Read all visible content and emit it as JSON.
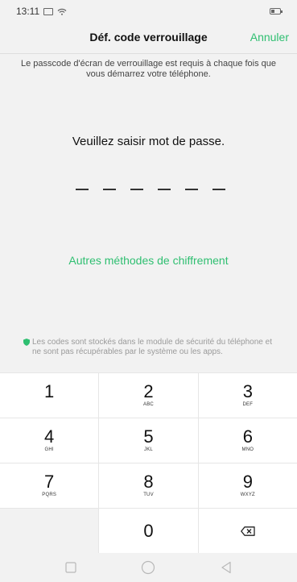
{
  "status": {
    "time": "13:11",
    "battery_level": 0.4
  },
  "header": {
    "title": "Déf. code verrouillage",
    "cancel_label": "Annuler"
  },
  "info_text": "Le passcode d'écran de verrouillage est requis à chaque fois que vous démarrez votre téléphone.",
  "prompt_text": "Veuillez saisir mot de passe.",
  "passcode": {
    "length": 6,
    "entered": 0
  },
  "alt_methods_label": "Autres méthodes de chiffrement",
  "security_note": "Les codes sont stockés dans le module de sécurité du téléphone et ne sont pas récupérables par le système ou les apps.",
  "keypad": {
    "rows": [
      [
        {
          "num": "1",
          "letters": ""
        },
        {
          "num": "2",
          "letters": "ABC"
        },
        {
          "num": "3",
          "letters": "DEF"
        }
      ],
      [
        {
          "num": "4",
          "letters": "GHI"
        },
        {
          "num": "5",
          "letters": "JKL"
        },
        {
          "num": "6",
          "letters": "MNO"
        }
      ],
      [
        {
          "num": "7",
          "letters": "PQRS"
        },
        {
          "num": "8",
          "letters": "TUV"
        },
        {
          "num": "9",
          "letters": "WXYZ"
        }
      ]
    ],
    "zero": "0"
  },
  "colors": {
    "accent": "#2fbf71",
    "background": "#f2f2f2"
  },
  "icons": {
    "delete": "backspace-icon",
    "home": "circle-home-icon",
    "recents": "square-recents-icon",
    "back": "triangle-back-icon"
  }
}
